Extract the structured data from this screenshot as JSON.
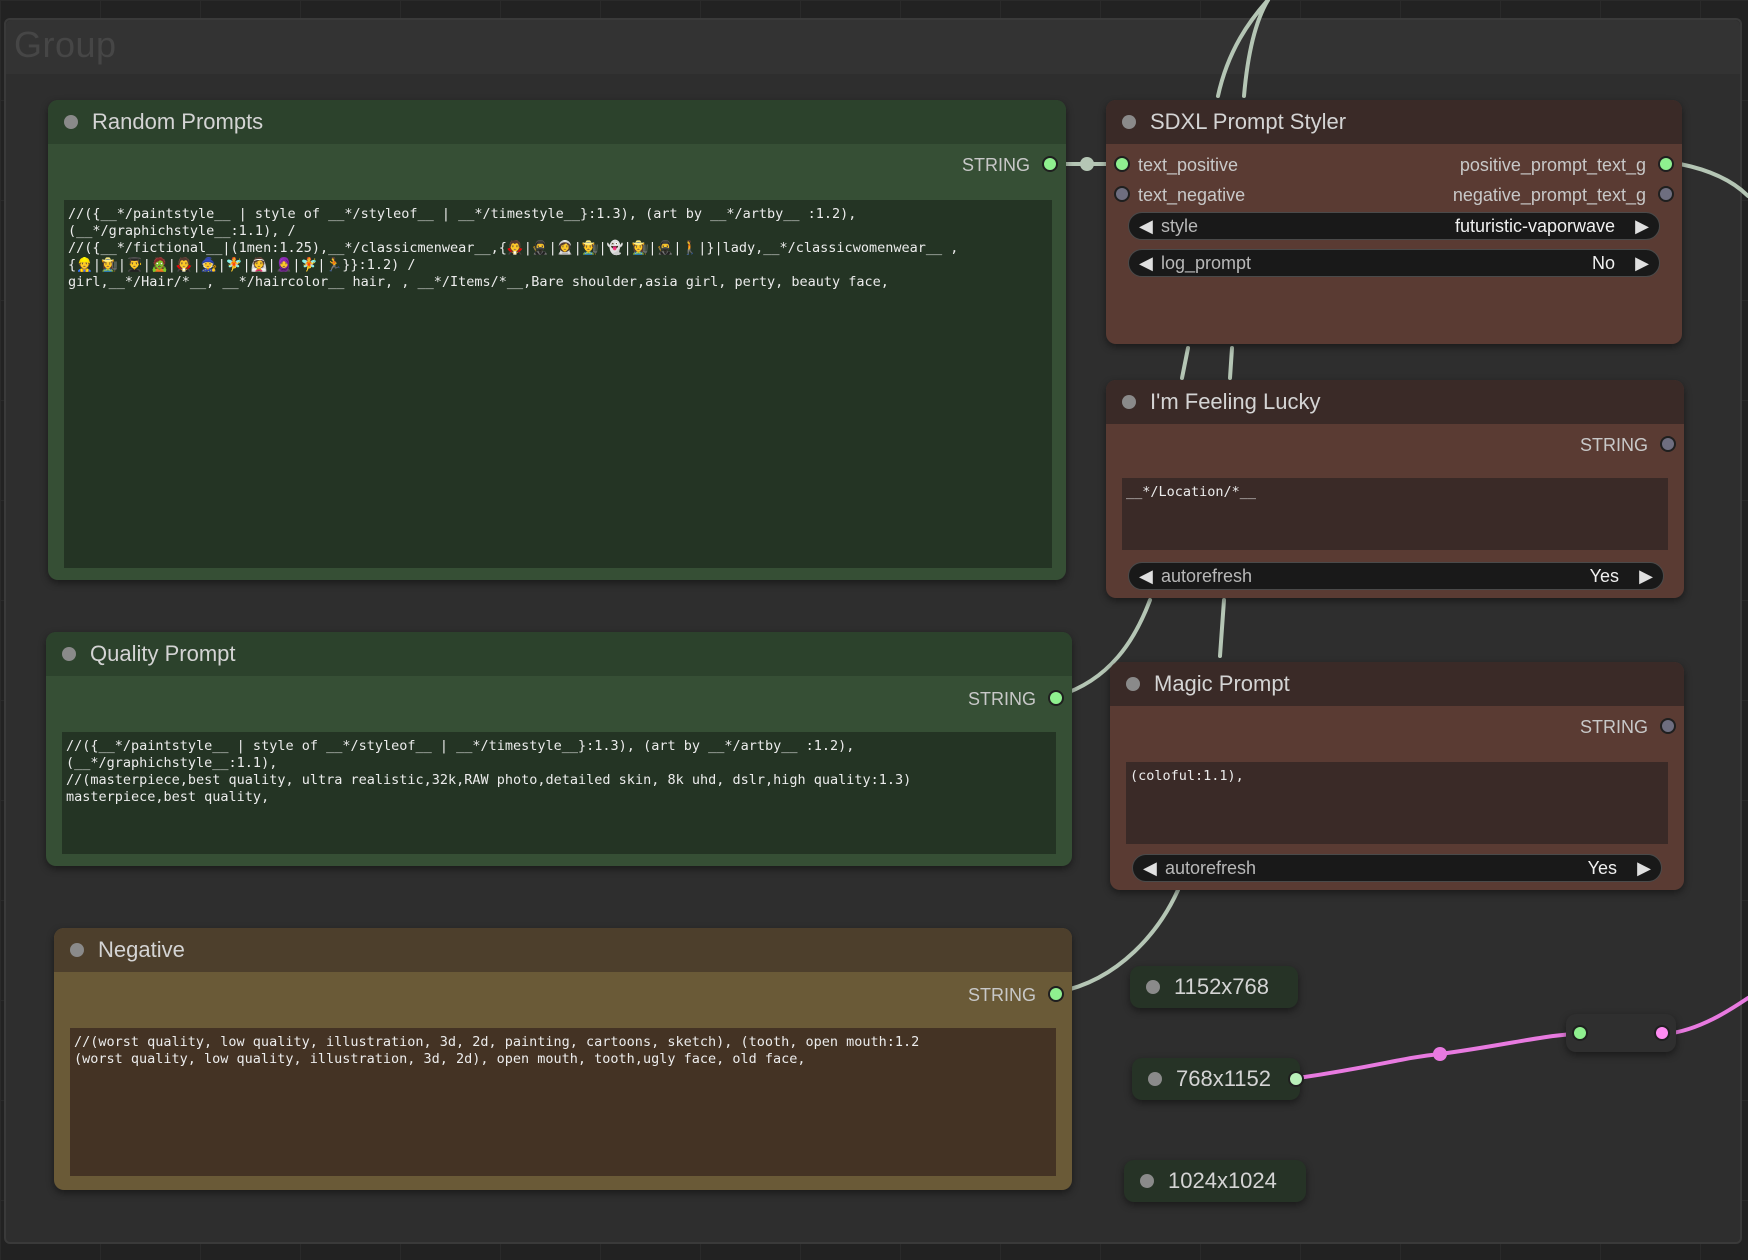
{
  "group": {
    "title": "Group"
  },
  "nodes": {
    "random_prompts": {
      "title": "Random Prompts",
      "output_label": "STRING",
      "text": "//({__*/paintstyle__ | style of __*/styleof__ | __*/timestyle__}:1.3), (art by __*/artby__ :1.2),\n(__*/graphichstyle__:1.1), /\n//({__*/fictional__|(1men:1.25),__*/classicmenwear__,{🧛|🥷|👩‍🚀|👨‍🌾|👻|👩‍🌾|🥷|🚶|}|lady,__*/classicwomenwear__ ,\n{👷|👩‍🌾|👨‍🎓|🧟|🧛|🧙|🧚|👰|🧕|🧚|🏃}}:1.2) /\ngirl,__*/Hair/*__, __*/haircolor__ hair, , __*/Items/*__,Bare shoulder,asia girl, perty, beauty face,"
    },
    "quality_prompt": {
      "title": "Quality Prompt",
      "output_label": "STRING",
      "text": "//({__*/paintstyle__ | style of __*/styleof__ | __*/timestyle__}:1.3), (art by __*/artby__ :1.2),\n(__*/graphichstyle__:1.1),\n//(masterpiece,best quality, ultra realistic,32k,RAW photo,detailed skin, 8k uhd, dslr,high quality:1.3)\nmasterpiece,best quality,"
    },
    "negative": {
      "title": "Negative",
      "output_label": "STRING",
      "text": "//(worst quality, low quality, illustration, 3d, 2d, painting, cartoons, sketch), (tooth, open mouth:1.2\n(worst quality, low quality, illustration, 3d, 2d), open mouth, tooth,ugly face, old face,"
    },
    "sdxl_styler": {
      "title": "SDXL Prompt Styler",
      "inputs": [
        "text_positive",
        "text_negative"
      ],
      "outputs": [
        "positive_prompt_text_g",
        "negative_prompt_text_g"
      ],
      "widgets": [
        {
          "name": "style",
          "value": "futuristic-vaporwave"
        },
        {
          "name": "log_prompt",
          "value": "No"
        }
      ]
    },
    "feeling_lucky": {
      "title": "I'm Feeling Lucky",
      "output_label": "STRING",
      "text": "__*/Location/*__",
      "widget": {
        "name": "autorefresh",
        "value": "Yes"
      }
    },
    "magic_prompt": {
      "title": "Magic Prompt",
      "output_label": "STRING",
      "text": "(coloful:1.1),",
      "widget": {
        "name": "autorefresh",
        "value": "Yes"
      }
    },
    "resolutions": [
      "1152x768",
      "768x1152",
      "1024x1024"
    ]
  },
  "colors": {
    "green_node": "#364f35",
    "brown_node": "#5a3b33",
    "olive_node": "#6a5a37",
    "wire_string": "#b5c6b5",
    "wire_pink": "#e87ae0",
    "slot_on": "#8ff08f"
  }
}
